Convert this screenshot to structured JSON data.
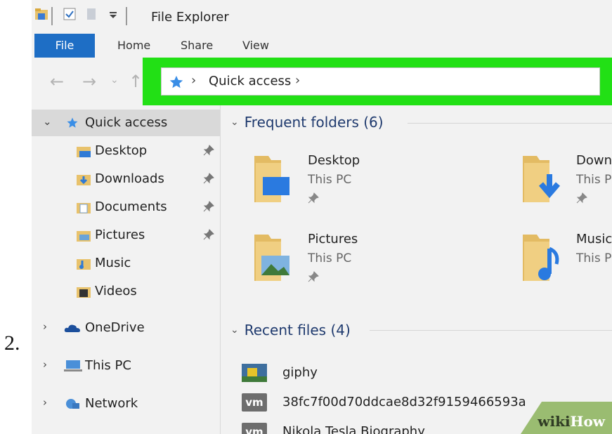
{
  "step_number": "2.",
  "window": {
    "title": "File Explorer"
  },
  "ribbon_tabs": [
    {
      "label": "File"
    },
    {
      "label": "Home"
    },
    {
      "label": "Share"
    },
    {
      "label": "View"
    }
  ],
  "address_bar": {
    "location": "Quick access",
    "highlight_color": "#22e015"
  },
  "nav_pane": {
    "quick_access": "Quick access",
    "pinned": [
      {
        "label": "Desktop"
      },
      {
        "label": "Downloads"
      },
      {
        "label": "Documents"
      },
      {
        "label": "Pictures"
      },
      {
        "label": "Music"
      },
      {
        "label": "Videos"
      }
    ],
    "roots": [
      {
        "label": "OneDrive",
        "icon": "cloud-icon"
      },
      {
        "label": "This PC",
        "icon": "computer-icon"
      },
      {
        "label": "Network",
        "icon": "network-icon"
      }
    ]
  },
  "frequent_folders": {
    "header": "Frequent folders (6)",
    "items": [
      {
        "name": "Desktop",
        "location": "This PC"
      },
      {
        "name": "Down",
        "location": "This P"
      },
      {
        "name": "Pictures",
        "location": "This PC"
      },
      {
        "name": "Music",
        "location": "This P"
      }
    ]
  },
  "recent_files": {
    "header": "Recent files (4)",
    "items": [
      {
        "name": "giphy",
        "icon": "image-icon"
      },
      {
        "name": "38fc7f00d70ddcae8d32f9159466593a",
        "icon": "vm-file-icon",
        "badge": "vm"
      },
      {
        "name": "Nikola Tesla Biography",
        "icon": "vm-file-icon",
        "badge": "vm"
      }
    ]
  },
  "watermark": {
    "part1": "wiki",
    "part2": "How"
  },
  "colors": {
    "accent": "#1e6ec5",
    "folder": "#e8c26c",
    "highlight": "#22e015"
  }
}
